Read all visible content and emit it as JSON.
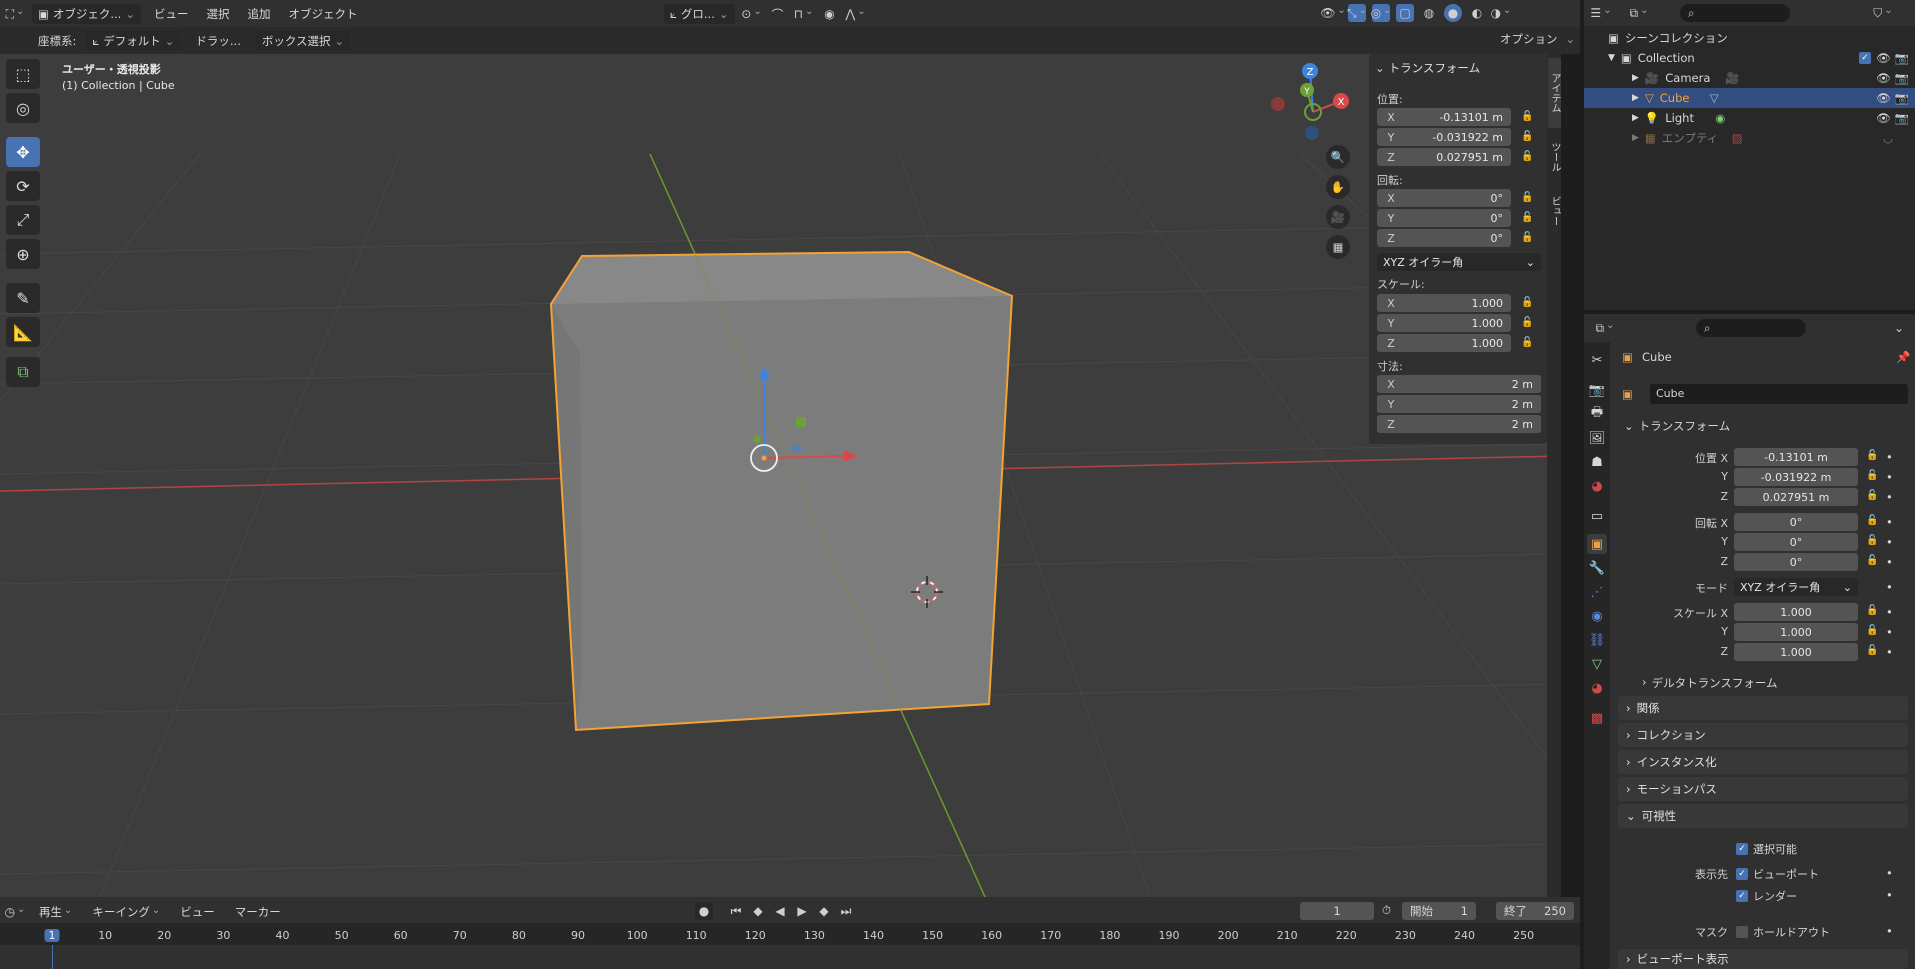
{
  "topbar": {
    "mode_label": "オブジェク...",
    "menus": [
      "ビュー",
      "選択",
      "追加",
      "オブジェクト"
    ],
    "transform_orientation": "グロ...",
    "options_label": "オプション"
  },
  "toolsettings": {
    "coord_label": "座標系:",
    "coord_value": "デフォルト",
    "drag_label": "ドラッ...",
    "select_mode": "ボックス選択"
  },
  "viewport": {
    "view_name": "ユーザー・透視投影",
    "context": "(1) Collection | Cube",
    "side_tabs": [
      "アイテム",
      "ツール",
      "ビュー"
    ],
    "gizmo_axes": [
      "Z",
      "Y",
      "X"
    ]
  },
  "npanel": {
    "title": "トランスフォーム",
    "location_label": "位置:",
    "location": [
      {
        "axis": "X",
        "value": "-0.13101 m"
      },
      {
        "axis": "Y",
        "value": "-0.031922 m"
      },
      {
        "axis": "Z",
        "value": "0.027951 m"
      }
    ],
    "rotation_label": "回転:",
    "rotation": [
      {
        "axis": "X",
        "value": "0°"
      },
      {
        "axis": "Y",
        "value": "0°"
      },
      {
        "axis": "Z",
        "value": "0°"
      }
    ],
    "rotation_mode": "XYZ オイラー角",
    "scale_label": "スケール:",
    "scale": [
      {
        "axis": "X",
        "value": "1.000"
      },
      {
        "axis": "Y",
        "value": "1.000"
      },
      {
        "axis": "Z",
        "value": "1.000"
      }
    ],
    "dimensions_label": "寸法:",
    "dimensions": [
      {
        "axis": "X",
        "value": "2 m"
      },
      {
        "axis": "Y",
        "value": "2 m"
      },
      {
        "axis": "Z",
        "value": "2 m"
      }
    ]
  },
  "outliner": {
    "scene_collection": "シーンコレクション",
    "collection": "Collection",
    "items": [
      "Camera",
      "Cube",
      "Light",
      "エンプティ"
    ]
  },
  "properties": {
    "object_name_header": "Cube",
    "object_name_field": "Cube",
    "transform_title": "トランスフォーム",
    "loc_label": "位置 X",
    "rot_label": "回転 X",
    "y_label": "Y",
    "z_label": "Z",
    "loc": [
      "-0.13101 m",
      "-0.031922 m",
      "0.027951 m"
    ],
    "rot": [
      "0°",
      "0°",
      "0°"
    ],
    "mode_label": "モード",
    "mode_value": "XYZ オイラー角",
    "scale_label": "スケール X",
    "scale": [
      "1.000",
      "1.000",
      "1.000"
    ],
    "delta": "デルタトランスフォーム",
    "sections": [
      "関係",
      "コレクション",
      "インスタンス化",
      "モーションパス"
    ],
    "visibility": "可視性",
    "selectable": "選択可能",
    "show_in_label": "表示先",
    "viewport": "ビューポート",
    "render": "レンダー",
    "mask_label": "マスク",
    "holdout": "ホールドアウト",
    "viewport_display": "ビューポート表示"
  },
  "timeline": {
    "menus": [
      "再生",
      "キーイング",
      "ビュー",
      "マーカー"
    ],
    "current_frame": "1",
    "start_label": "開始",
    "start_value": "1",
    "end_label": "終了",
    "end_value": "250",
    "ticks": [
      "1",
      "10",
      "20",
      "30",
      "40",
      "50",
      "60",
      "70",
      "80",
      "90",
      "100",
      "110",
      "120",
      "130",
      "140",
      "150",
      "160",
      "170",
      "180",
      "190",
      "200",
      "210",
      "220",
      "230",
      "240",
      "250"
    ]
  },
  "colors": {
    "accent": "#4772b3",
    "selection_orange": "#f5a235",
    "x_axis": "#d84a4a",
    "y_axis": "#7bb431",
    "z_axis": "#3d84e0"
  }
}
